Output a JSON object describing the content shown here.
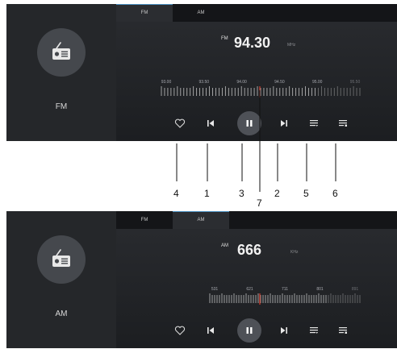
{
  "fm_panel": {
    "source_label": "FM",
    "tabs": [
      {
        "label": "FM",
        "active": true
      },
      {
        "label": "AM",
        "active": false
      }
    ],
    "band_mini": "FM",
    "frequency": "94.30",
    "unit": "MHz",
    "scale_labels": [
      "93.00",
      "93.50",
      "94.00",
      "94.50",
      "95.00",
      "95.50"
    ]
  },
  "am_panel": {
    "source_label": "AM",
    "tabs": [
      {
        "label": "FM",
        "active": false
      },
      {
        "label": "AM",
        "active": true
      }
    ],
    "band_mini": "AM",
    "frequency": "666",
    "unit": "KHz",
    "scale_labels": [
      "531",
      "621",
      "711",
      "801",
      "891"
    ]
  },
  "controls": [
    "favorite-icon",
    "previous-icon",
    "pause-icon",
    "next-icon",
    "list-icon",
    "playlist-icon"
  ],
  "callouts": [
    "4",
    "1",
    "3",
    "7",
    "2",
    "5",
    "6"
  ],
  "colors": {
    "background": "#1d1f22",
    "accent_tab": "#4a8fc0",
    "needle": "#c0392b",
    "text": "#f2f2f2"
  }
}
